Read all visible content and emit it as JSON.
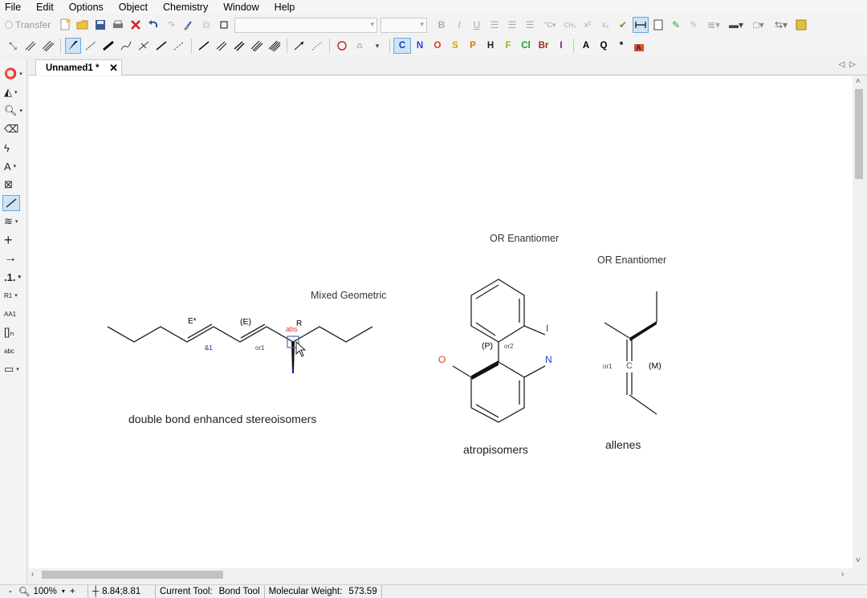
{
  "menu": [
    "File",
    "Edit",
    "Options",
    "Object",
    "Chemistry",
    "Window",
    "Help"
  ],
  "toolbar": {
    "transfer_label": "Transfer"
  },
  "elements": [
    {
      "symbol": "C",
      "color": "#1a3a9a"
    },
    {
      "symbol": "N",
      "color": "#2a3ad0"
    },
    {
      "symbol": "O",
      "color": "#e03a1a"
    },
    {
      "symbol": "S",
      "color": "#e0a000"
    },
    {
      "symbol": "P",
      "color": "#e07a00"
    },
    {
      "symbol": "H",
      "color": "#222222"
    },
    {
      "symbol": "F",
      "color": "#80c020"
    },
    {
      "symbol": "Cl",
      "color": "#20a020"
    },
    {
      "symbol": "Br",
      "color": "#a02a1a"
    },
    {
      "symbol": "I",
      "color": "#7a1a8a"
    },
    {
      "symbol": "A",
      "color": "#222222"
    },
    {
      "symbol": "Q",
      "color": "#222222"
    },
    {
      "symbol": "*",
      "color": "#222222"
    }
  ],
  "tab": {
    "title": "Unnamed1 *"
  },
  "canvas": {
    "mixed_geometric": "Mixed Geometric",
    "or_enantiomer_1": "OR Enantiomer",
    "or_enantiomer_2": "OR Enantiomer",
    "E_star": "E*",
    "E_paren": "(E)",
    "abs": "abs",
    "R": "R",
    "amp1": "&1",
    "or1_a": "or1",
    "caption_double_bond": "double bond enhanced stereoisomers",
    "P_label": "(P)",
    "or2": "or2",
    "I_atom": "I",
    "O_atom": "O",
    "N_atom": "N",
    "caption_atropisomers": "atropisomers",
    "or1_b": "or1",
    "C_atom": "C",
    "M_label": "(M)",
    "caption_allenes": "allenes"
  },
  "status": {
    "zoom": "100%",
    "coords": "8.84;8.81",
    "current_tool_label": "Current Tool:",
    "current_tool_value": "Bond Tool",
    "mw_label": "Molecular Weight:",
    "mw_value": "573.59"
  },
  "colors": {
    "accent": "#6ea5d8",
    "selected_bg": "#cde3f7",
    "abs_red": "#e03030",
    "enhanced_blue": "#1a1aa0"
  }
}
